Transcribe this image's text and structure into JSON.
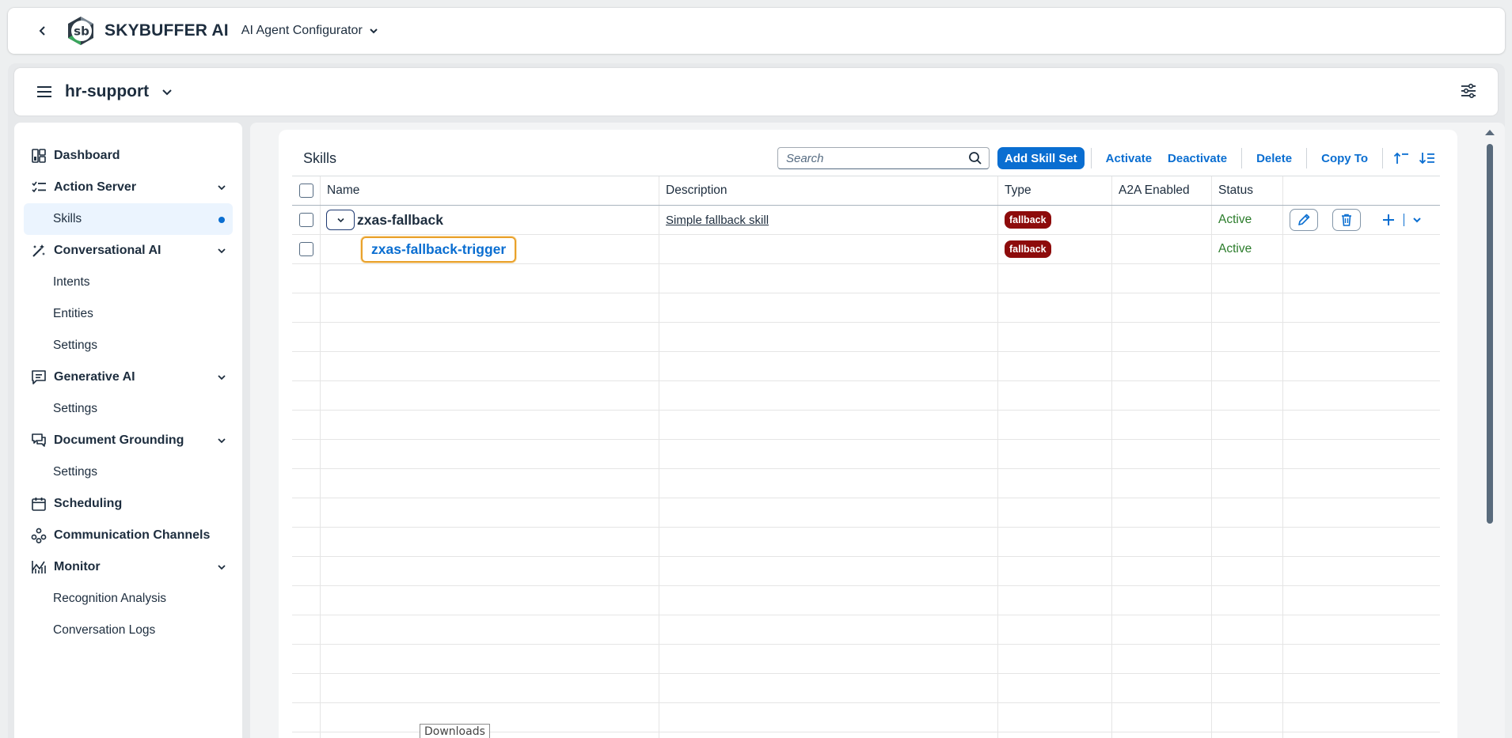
{
  "shell": {
    "brand": "SKYBUFFER AI",
    "product": "AI Agent Configurator",
    "logo_text": "sb"
  },
  "workspace": {
    "name": "hr-support"
  },
  "sidebar": {
    "items": [
      {
        "label": "Dashboard",
        "icon": "dashboard-icon",
        "expandable": false
      },
      {
        "label": "Action Server",
        "icon": "checklist-icon",
        "expandable": true,
        "children": [
          {
            "label": "Skills",
            "selected": true
          }
        ]
      },
      {
        "label": "Conversational AI",
        "icon": "magic-wand-icon",
        "expandable": true,
        "children": [
          {
            "label": "Intents"
          },
          {
            "label": "Entities"
          },
          {
            "label": "Settings"
          }
        ]
      },
      {
        "label": "Generative AI",
        "icon": "chat-icon",
        "expandable": true,
        "children": [
          {
            "label": "Settings"
          }
        ]
      },
      {
        "label": "Document Grounding",
        "icon": "discussion-icon",
        "expandable": true,
        "children": [
          {
            "label": "Settings"
          }
        ]
      },
      {
        "label": "Scheduling",
        "icon": "calendar-icon",
        "expandable": false
      },
      {
        "label": "Communication Channels",
        "icon": "channels-icon",
        "expandable": false
      },
      {
        "label": "Monitor",
        "icon": "monitor-icon",
        "expandable": true,
        "children": [
          {
            "label": "Recognition Analysis"
          },
          {
            "label": "Conversation Logs"
          }
        ]
      }
    ]
  },
  "toolbar": {
    "title": "Skills",
    "search_placeholder": "Search",
    "add_label": "Add Skill Set",
    "activate_label": "Activate",
    "deactivate_label": "Deactivate",
    "delete_label": "Delete",
    "copy_label": "Copy To"
  },
  "table": {
    "columns": [
      "Name",
      "Description",
      "Type",
      "A2A Enabled",
      "Status"
    ],
    "rows": [
      {
        "name": "zxas-fallback",
        "description": "Simple fallback skill",
        "type": "fallback",
        "a2a": "",
        "status": "Active"
      },
      {
        "name": "zxas-fallback-trigger",
        "description": "",
        "type": "fallback",
        "a2a": "",
        "status": "Active"
      }
    ]
  },
  "tooltip": "Downloads",
  "colors": {
    "accent": "#0a6ed1",
    "badge": "#8d0b0b",
    "active": "#2b7c2b",
    "focus": "#e9a12b"
  }
}
